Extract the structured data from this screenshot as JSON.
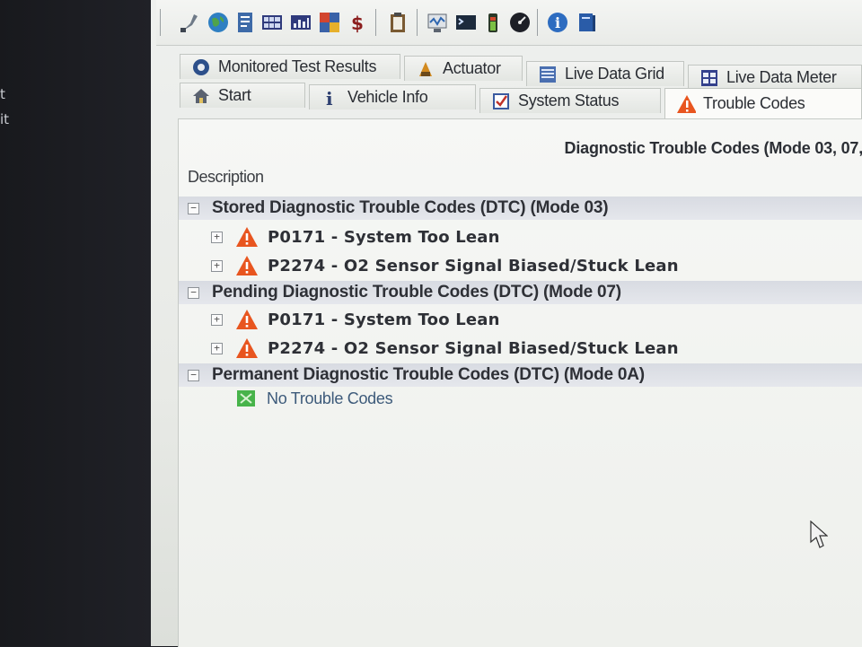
{
  "desktop_fragments": [
    "t",
    "it"
  ],
  "toolbar": {
    "buttons": [
      "connection-icon",
      "globe-icon",
      "report-icon",
      "grid-icon",
      "chart-icon",
      "puzzle-icon",
      "dollar-icon",
      "clipboard-icon",
      "scope-icon",
      "terminal-icon",
      "battery-icon",
      "gauge-icon",
      "info-icon",
      "book-icon"
    ]
  },
  "tabs": {
    "row1": [
      "Monitored Test Results",
      "Actuator",
      "Live Data Grid",
      "Live Data Meter"
    ],
    "row2": [
      "Start",
      "Vehicle Info",
      "System Status",
      "Trouble Codes"
    ],
    "active": "Trouble Codes"
  },
  "panel": {
    "title": "Diagnostic Trouble Codes (Mode 03, 07,",
    "column_header": "Description"
  },
  "groups": [
    {
      "label": "Stored Diagnostic Trouble Codes (DTC) (Mode 03)",
      "codes": [
        "P0171 - System Too Lean",
        "P2274 - O2 Sensor Signal Biased/Stuck Lean"
      ]
    },
    {
      "label": "Pending Diagnostic Trouble Codes (DTC) (Mode 07)",
      "codes": [
        "P0171 - System Too Lean",
        "P2274 - O2 Sensor Signal Biased/Stuck Lean"
      ]
    },
    {
      "label": "Permanent Diagnostic Trouble Codes (DTC) (Mode 0A)",
      "none": "No Trouble Codes"
    }
  ],
  "colors": {
    "warning": "#e8551f",
    "ok": "#47b34a",
    "group_band": "#dcdfe5"
  }
}
